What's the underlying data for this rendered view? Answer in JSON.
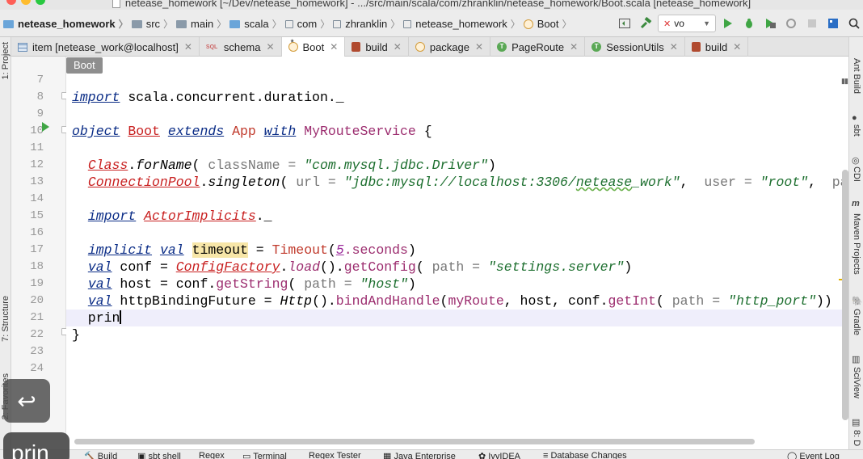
{
  "window": {
    "title": "netease_homework [~/Dev/netease_homework] - .../src/main/scala/com/zhranklin/netease_homework/Boot.scala [netease_homework]"
  },
  "breadcrumbs": [
    "netease_homework",
    "src",
    "main",
    "scala",
    "com",
    "zhranklin",
    "netease_homework",
    "Boot"
  ],
  "toolbar": {
    "run_config": "vo"
  },
  "tabs": [
    {
      "label": "item [netease_work@localhost]",
      "icon": "table-icon",
      "active": false,
      "modified": false
    },
    {
      "label": "schema",
      "icon": "sql-icon",
      "active": false,
      "modified": false
    },
    {
      "label": "Boot",
      "icon": "object-icon",
      "active": true,
      "modified": true
    },
    {
      "label": "build",
      "icon": "sbt-icon",
      "active": false,
      "modified": false
    },
    {
      "label": "package",
      "icon": "object-icon",
      "active": false,
      "modified": false
    },
    {
      "label": "PageRoute",
      "icon": "trait-icon",
      "active": false,
      "modified": false
    },
    {
      "label": "SessionUtils",
      "icon": "trait-icon",
      "active": false,
      "modified": false
    },
    {
      "label": "build",
      "icon": "sbt-icon",
      "active": false,
      "modified": false
    }
  ],
  "editor": {
    "crumb_label": "Boot",
    "line_numbers": [
      "7",
      "8",
      "9",
      "10",
      "11",
      "12",
      "13",
      "14",
      "15",
      "16",
      "17",
      "18",
      "19",
      "20",
      "21",
      "22",
      "23",
      "24"
    ],
    "current_line": "21"
  },
  "left_tools": [
    "1: Project",
    "7: Structure",
    "2: Favorites"
  ],
  "right_tools": [
    "Ant Build",
    "sbt",
    "CDI",
    "Maven Projects",
    "Gradle",
    "SciView",
    "8: D"
  ],
  "bottom_tools": [
    "Build",
    "sbt shell",
    "Regex",
    "Terminal",
    "Regex Tester",
    "Java Enterprise",
    "IvyIDEA",
    "Database Changes",
    "Event Log"
  ],
  "overlays": {
    "key": "↩",
    "typed": "prin"
  }
}
